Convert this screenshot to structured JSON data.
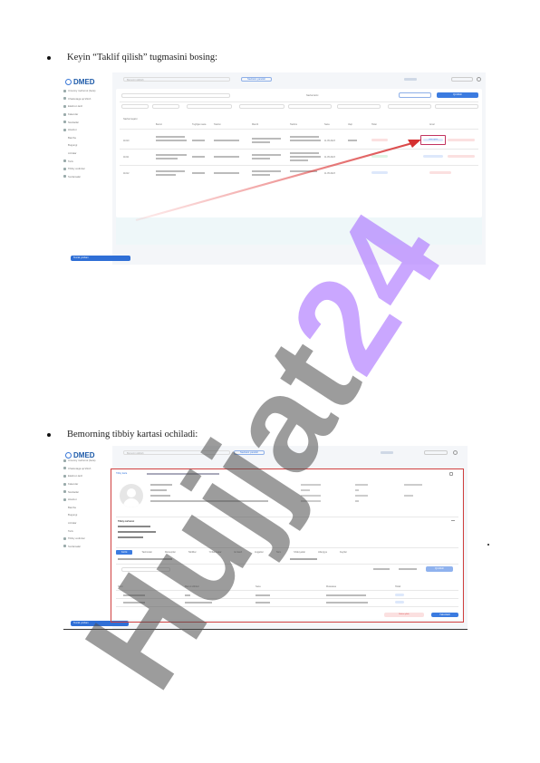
{
  "document": {
    "step1": "Keyin “Taklif qilish” tugmasini bosing:",
    "step2": "Bemorning tibbiy kartasi ochiladi:"
  },
  "app": {
    "logo": "DMED",
    "sidebar": [
      "Umumiy ma'lumot (beta)",
      "Chastotaga qo'shish",
      "Elektron lavh",
      "Kalendar",
      "Navbatlar",
      "Hisobot",
      "Barcha",
      "Bugungi",
      "Arizalar",
      "Tarix",
      "Tibbiy xodimlar",
      "Sozlamalar"
    ],
    "search_placeholder": "Bemorni qidirish",
    "status_label": "Navbatni yaratish",
    "help_button": "Texnik yordam",
    "history_title": "Navbat tarixi",
    "add_button": "Qo'shish",
    "table_headers": [
      "Navbat raqami",
      "Bemor",
      "Tug'ilgan sana",
      "Telefon",
      "Manzil",
      "Tashxis",
      "Sana",
      "Vaqt",
      "Holat",
      "Amal"
    ],
    "table_rows": [
      {
        "num": "11010",
        "date": "11.05.2023",
        "status": "Taklif qilish"
      },
      {
        "num": "11011",
        "date": "11.05.2023",
        "status": "Kutilmoqda"
      },
      {
        "num": "11012",
        "date": "11.05.2023",
        "status": "Yakunlangan"
      }
    ],
    "invite_button": "Taklif qilish",
    "card": {
      "breadcrumb": "Tibbiy karta",
      "info_title": "Tibbiy ma'lumot",
      "tabs": [
        "Ko'rik",
        "Tashxislar",
        "Retseptlar",
        "Tahlillar",
        "Yo'llanmalar",
        "Emlash",
        "Hujjatlar",
        "Tarix",
        "Shikoyatlar",
        "Allergiya",
        "Fayllar"
      ],
      "table_headers": [
        "Nomi",
        "Mas'ul shifokor",
        "Sana",
        "Muassasa",
        "Holati"
      ],
      "complete_button": "Yakunlash",
      "cancel_button": "Bekor qilish"
    }
  },
  "watermark": "Hujjat24"
}
